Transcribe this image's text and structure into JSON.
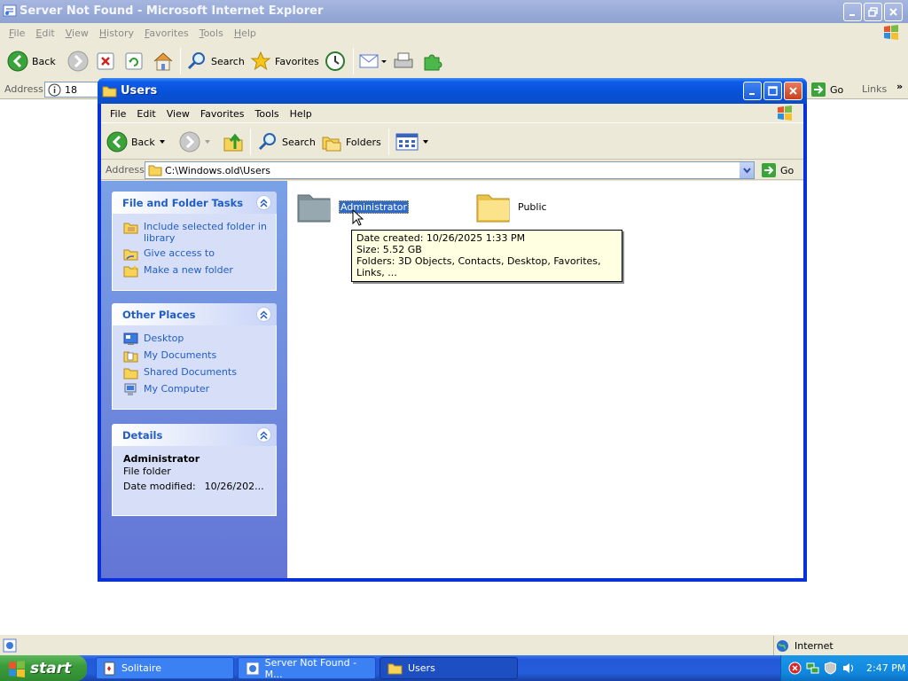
{
  "ie": {
    "title": "Server Not Found - Microsoft Internet Explorer",
    "menu": [
      "File",
      "Edit",
      "View",
      "History",
      "Favorites",
      "Tools",
      "Help"
    ],
    "toolbar": {
      "back": "Back",
      "search": "Search",
      "favorites": "Favorites"
    },
    "address_label": "Address",
    "address_value": "18",
    "go": "Go",
    "links": "Links",
    "links_chevron": "»",
    "status_zone": "Internet"
  },
  "explorer": {
    "title": "Users",
    "menu": [
      "File",
      "Edit",
      "View",
      "Favorites",
      "Tools",
      "Help"
    ],
    "toolbar": {
      "back": "Back",
      "search": "Search",
      "folders": "Folders"
    },
    "address_label": "Address",
    "address_value": "C:\\Windows.old\\Users",
    "go": "Go",
    "tasks_panel": {
      "title": "File and Folder Tasks",
      "items": [
        "Include selected folder in library",
        "Give access to",
        "Make a new folder"
      ]
    },
    "places_panel": {
      "title": "Other Places",
      "items": [
        "Desktop",
        "My Documents",
        "Shared Documents",
        "My Computer"
      ]
    },
    "details_panel": {
      "title": "Details",
      "name": "Administrator",
      "type": "File folder",
      "modified_label": "Date modified:",
      "modified_value": "10/26/202..."
    },
    "files": [
      {
        "name": "Administrator",
        "selected": true,
        "icon": "folder-icon-gray"
      },
      {
        "name": "Public",
        "selected": false,
        "icon": "folder-icon-yellow"
      }
    ],
    "tooltip": {
      "date_created": "Date created: 10/26/2025 1:33 PM",
      "size": "Size: 5.52 GB",
      "folders": "Folders: 3D Objects, Contacts, Desktop, Favorites, Links, ..."
    }
  },
  "taskbar": {
    "start": "start",
    "buttons": [
      "Solitaire",
      "Server Not Found - M...",
      "Users"
    ],
    "clock": "2:47 PM"
  },
  "colors": {
    "xp_blue": "#0831d9",
    "taskpane_link": "#215dc6",
    "selection": "#316ac5",
    "start_green": "#3c9c3c",
    "tooltip_bg": "#ffffe1"
  }
}
